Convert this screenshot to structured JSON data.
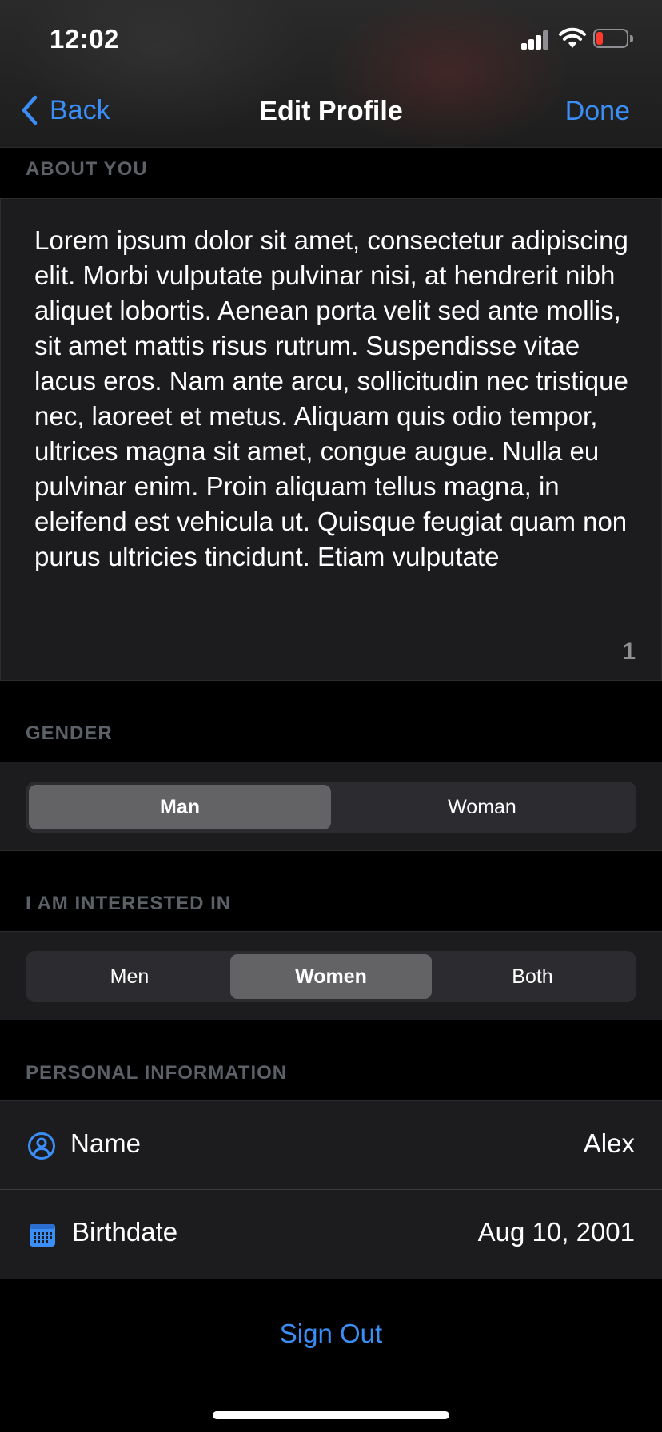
{
  "status_bar": {
    "time": "12:02"
  },
  "nav": {
    "back_label": "Back",
    "title": "Edit Profile",
    "done_label": "Done"
  },
  "about": {
    "section_label": "ABOUT YOU",
    "text": "Lorem ipsum dolor sit amet, consectetur adipiscing elit. Morbi vulputate pulvinar nisi, at hendrerit nibh aliquet lobortis. Aenean porta velit sed ante mollis, sit amet mattis risus rutrum. Suspendisse vitae lacus eros. Nam ante arcu, sollicitudin nec tristique nec, laoreet et metus. Aliquam quis odio tempor, ultrices magna sit amet, congue augue. Nulla eu pulvinar enim. Proin aliquam tellus magna, in eleifend est vehicula ut. Quisque feugiat quam non purus ultricies tincidunt. Etiam vulputate",
    "char_count": "1"
  },
  "gender": {
    "section_label": "GENDER",
    "options": [
      "Man",
      "Woman"
    ],
    "selected": "Man"
  },
  "interested": {
    "section_label": "I AM INTERESTED IN",
    "options": [
      "Men",
      "Women",
      "Both"
    ],
    "selected": "Women"
  },
  "personal": {
    "section_label": "PERSONAL INFORMATION",
    "name_label": "Name",
    "name_value": "Alex",
    "birthdate_label": "Birthdate",
    "birthdate_value": "Aug 10, 2001"
  },
  "signout_label": "Sign Out",
  "colors": {
    "accent": "#3a8ef6",
    "background": "#000000",
    "cell": "#1c1c1e",
    "segment_selected": "#636366",
    "battery_low": "#ff3b30"
  },
  "icons": {
    "back": "chevron-left-icon",
    "name": "person-circle-icon",
    "birthdate": "calendar-icon",
    "signal": "cellular-signal-icon",
    "wifi": "wifi-icon",
    "battery": "battery-low-icon"
  }
}
